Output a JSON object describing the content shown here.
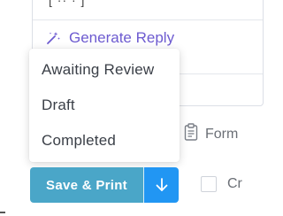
{
  "card": {
    "top_text": "[ ·· · ]",
    "generate_reply_label": "Generate Reply"
  },
  "menu": {
    "items": [
      {
        "label": "Awaiting Review"
      },
      {
        "label": "Draft"
      },
      {
        "label": "Completed"
      }
    ]
  },
  "split_button": {
    "main_label": "Save & Print"
  },
  "right_controls": {
    "form_label": "Form",
    "checkbox_label": "Cr"
  },
  "colors": {
    "accent_purple": "#6d5bd0",
    "button_main": "#4aa6c8",
    "button_arrow": "#2196f3"
  }
}
